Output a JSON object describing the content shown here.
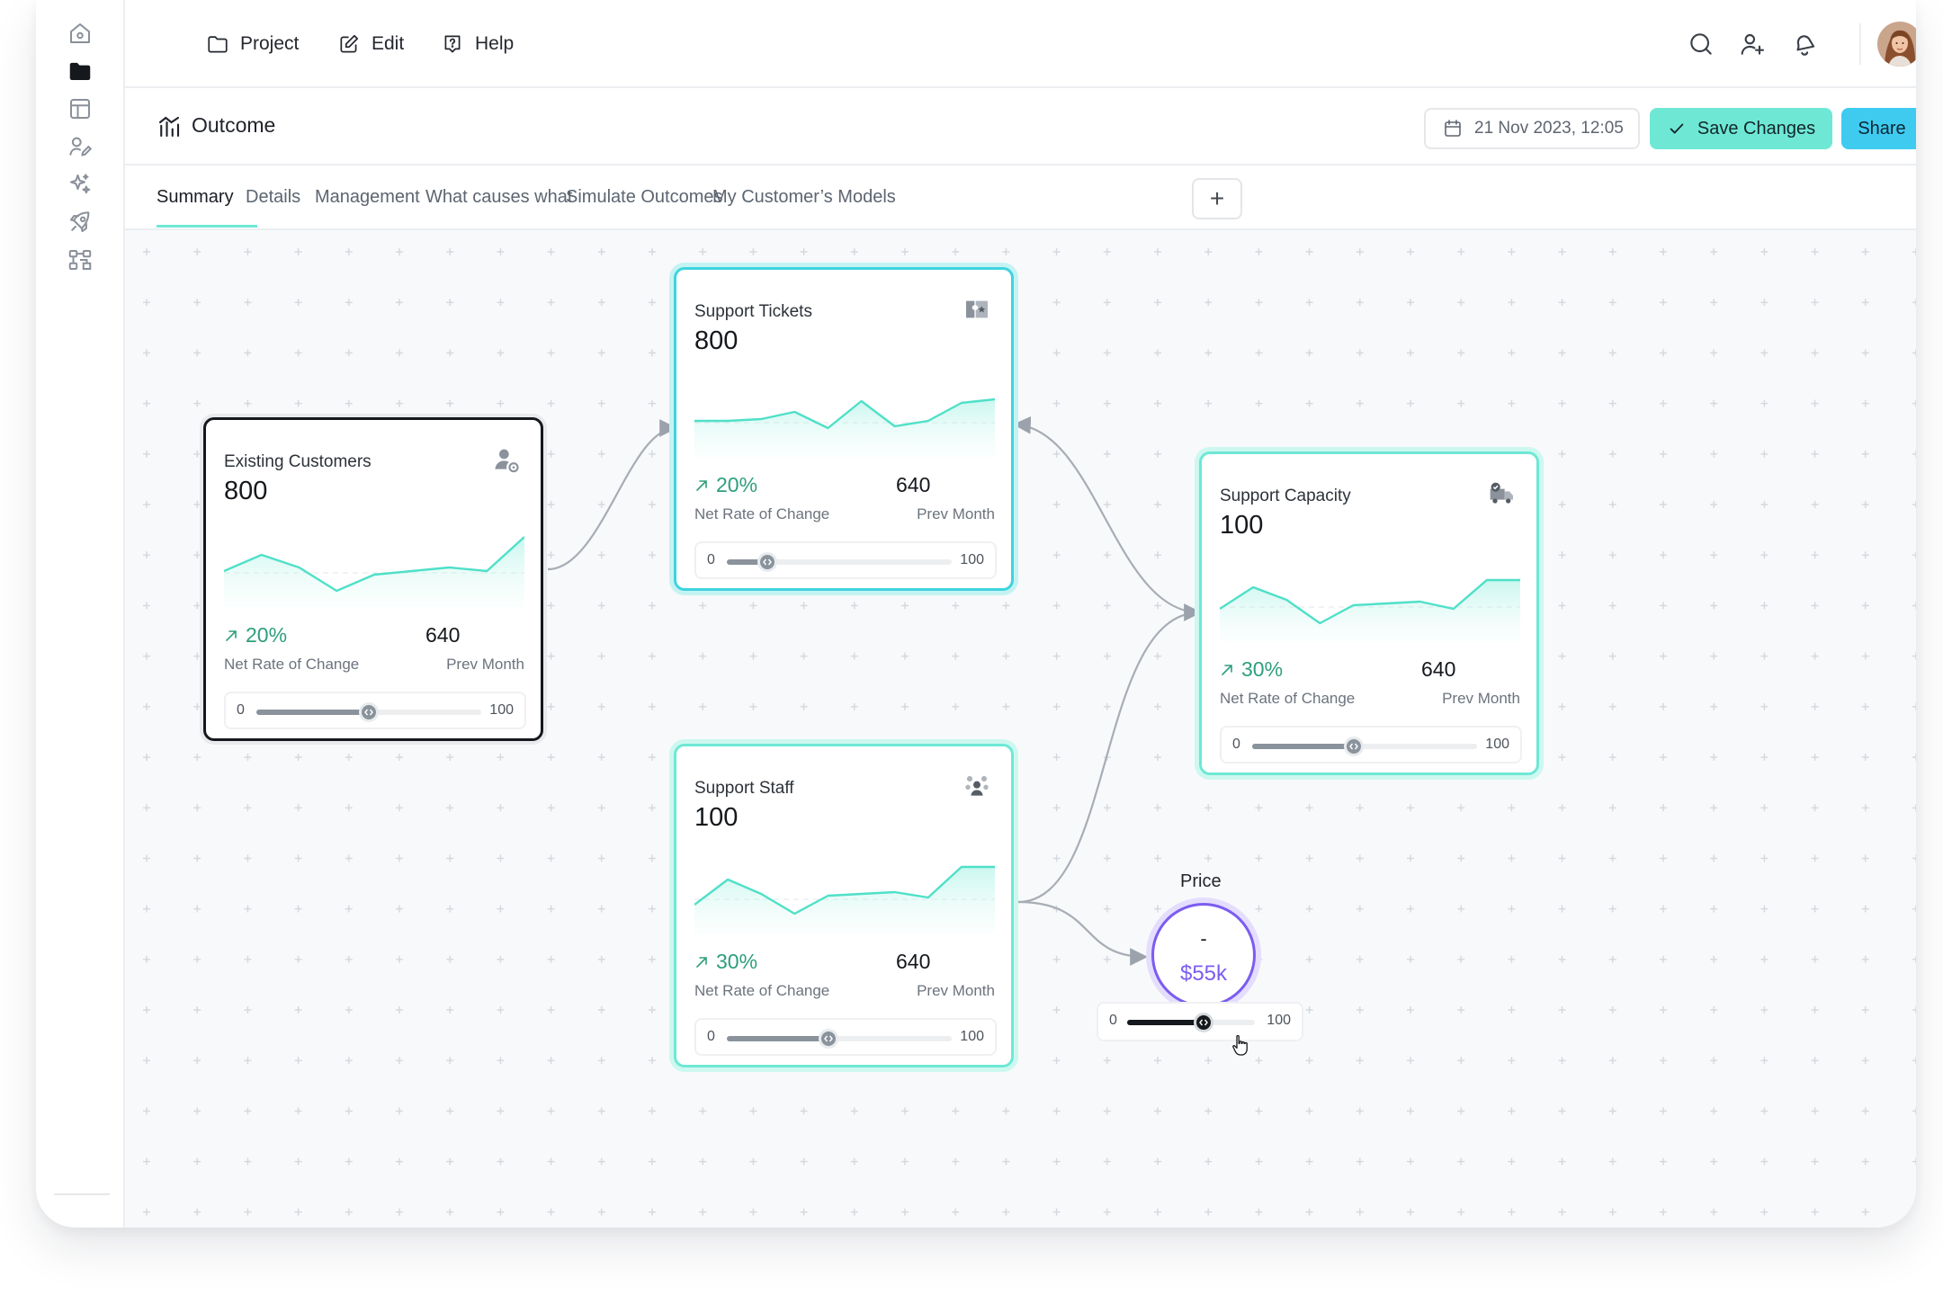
{
  "nav": {
    "menu": [
      {
        "label": "Project",
        "icon": "folder-icon"
      },
      {
        "label": "Edit",
        "icon": "edit-icon"
      },
      {
        "label": "Help",
        "icon": "help-icon"
      }
    ],
    "right_icons": [
      "search-icon",
      "add-user-icon",
      "bell-icon",
      "avatar"
    ]
  },
  "sidebar": {
    "items": [
      {
        "icon": "home-icon",
        "active": false
      },
      {
        "icon": "folder-icon",
        "active": true
      },
      {
        "icon": "layout-icon",
        "active": false
      },
      {
        "icon": "user-edit-icon",
        "active": false
      },
      {
        "icon": "sparkles-icon",
        "active": false
      },
      {
        "icon": "rocket-icon",
        "active": false
      },
      {
        "icon": "diagram-icon",
        "active": false
      }
    ]
  },
  "header": {
    "title": "Outcome",
    "datetime": "21 Nov 2023, 12:05",
    "save_label": "Save Changes",
    "share_label": "Share"
  },
  "tabs": {
    "items": [
      "Summary",
      "Details",
      "Management",
      "What causes what",
      "Simulate Outcomes",
      "My Customer’s Models"
    ],
    "active": "Summary",
    "add_label": "+"
  },
  "cards": [
    {
      "title": "Existing Customers",
      "value": "800",
      "icon": "user-settings-icon",
      "rate": "20%",
      "rate_label": "Net Rate of Change",
      "prev": "640",
      "prev_label": "Prev Month",
      "slider": {
        "min": "0",
        "max": "100",
        "value": 50
      },
      "trend": [
        40,
        58,
        44,
        18,
        36,
        40,
        44,
        40,
        78
      ]
    },
    {
      "title": "Support Tickets",
      "value": "800",
      "icon": "ticket-icon",
      "rate": "20%",
      "rate_label": "Net Rate of Change",
      "prev": "640",
      "prev_label": "Prev Month",
      "slider": {
        "min": "0",
        "max": "100",
        "value": 18
      },
      "trend": [
        40,
        40,
        42,
        50,
        32,
        62,
        34,
        40,
        60,
        64
      ]
    },
    {
      "title": "Support Capacity",
      "value": "100",
      "icon": "truck-check-icon",
      "rate": "30%",
      "rate_label": "Net Rate of Change",
      "prev": "640",
      "prev_label": "Prev Month",
      "slider": {
        "min": "0",
        "max": "100",
        "value": 45
      },
      "trend": [
        36,
        60,
        46,
        20,
        40,
        42,
        44,
        36,
        68,
        68
      ]
    },
    {
      "title": "Support Staff",
      "value": "100",
      "icon": "team-icon",
      "rate": "30%",
      "rate_label": "Net Rate of Change",
      "prev": "640",
      "prev_label": "Prev Month",
      "slider": {
        "min": "0",
        "max": "100",
        "value": 45
      },
      "trend": [
        32,
        60,
        44,
        22,
        42,
        44,
        46,
        40,
        74,
        74
      ]
    }
  ],
  "price": {
    "label": "Price",
    "dash": "-",
    "value": "$55k",
    "slider": {
      "min": "0",
      "max": "100",
      "value": 60
    }
  },
  "colors": {
    "accent_mint": "#6ee8d5",
    "accent_cyan": "#3fcbf0",
    "rate_green": "#2e9e7d",
    "price_purple": "#7b5cf0"
  }
}
